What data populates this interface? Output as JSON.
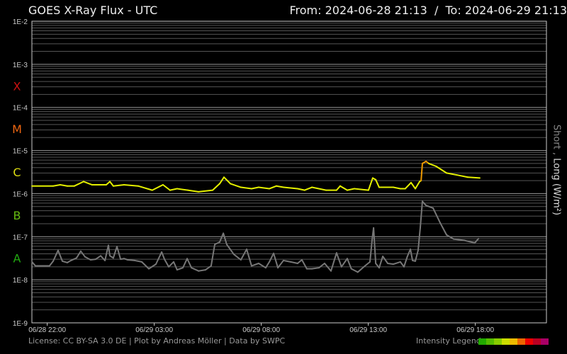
{
  "header": {
    "title": "GOES X-Ray Flux - UTC",
    "range": "From: 2024-06-28 21:13  /  To: 2024-06-29 21:13"
  },
  "footer": {
    "license": "License: CC BY-SA 3.0 DE | Plot by Andreas Möller | Data by SWPC",
    "legend_label": "Intensity Legend"
  },
  "legend_colors": [
    "#22aa00",
    "#55bb00",
    "#88cc00",
    "#ccdd00",
    "#eebb00",
    "#ee6600",
    "#ee0000",
    "#bb0022",
    "#aa0066"
  ],
  "chart_data": {
    "type": "line",
    "title": "GOES X-Ray Flux - UTC",
    "ylabel_short": "Short ,",
    "ylabel_long": "Long (W/m²)",
    "yscale": "log",
    "ylim": [
      1e-09,
      0.01
    ],
    "ytick_labels": [
      "1E-2",
      "1E-3",
      "1E-4",
      "1E-5",
      "1E-6",
      "1E-7",
      "1E-8",
      "1E-9"
    ],
    "classes": [
      {
        "label": "X",
        "color": "#cc1111",
        "log": -3.5
      },
      {
        "label": "M",
        "color": "#ee6611",
        "log": -4.5
      },
      {
        "label": "C",
        "color": "#dddd11",
        "log": -5.5
      },
      {
        "label": "B",
        "color": "#66bb11",
        "log": -6.5
      },
      {
        "label": "A",
        "color": "#22aa11",
        "log": -7.5
      }
    ],
    "xlim_hours": [
      0,
      24
    ],
    "x_start": "06/28 21:13",
    "xticks": [
      {
        "label": "06/28 22:00",
        "h": 0.783
      },
      {
        "label": "06/29 03:00",
        "h": 5.783
      },
      {
        "label": "06/29 08:00",
        "h": 10.783
      },
      {
        "label": "06/29 13:00",
        "h": 15.783
      },
      {
        "label": "06/29 18:00",
        "h": 20.783
      }
    ],
    "grid": true,
    "series": [
      {
        "name": "Long",
        "color": "#e4f000",
        "flare_color": "#ee9900",
        "points_x_pixels_note": "",
        "hours": [
          0.07,
          1.06,
          1.39,
          1.72,
          2.05,
          2.48,
          2.88,
          3.54,
          3.71,
          3.87,
          4.37,
          5.03,
          5.69,
          6.19,
          6.52,
          6.85,
          7.35,
          7.85,
          8.51,
          8.84,
          9.04,
          9.34,
          9.83,
          10.33,
          10.66,
          11.16,
          11.49,
          11.82,
          12.48,
          12.81,
          13.15,
          13.81,
          14.3,
          14.47,
          14.8,
          15.13,
          15.79,
          15.99,
          16.13,
          16.29,
          16.62,
          16.95,
          17.28,
          17.51,
          17.78,
          17.98,
          18.18,
          18.25,
          18.31,
          18.48,
          18.61,
          18.95,
          19.44,
          19.93,
          20.43,
          20.99
        ],
        "flux": [
          1.5e-06,
          1.5e-06,
          1.6e-06,
          1.5e-06,
          1.5e-06,
          1.9e-06,
          1.6e-06,
          1.6e-06,
          1.9e-06,
          1.5e-06,
          1.6e-06,
          1.5e-06,
          1.2e-06,
          1.6e-06,
          1.2e-06,
          1.3e-06,
          1.2e-06,
          1.1e-06,
          1.2e-06,
          1.7e-06,
          2.4e-06,
          1.7e-06,
          1.4e-06,
          1.3e-06,
          1.4e-06,
          1.3e-06,
          1.5e-06,
          1.4e-06,
          1.3e-06,
          1.2e-06,
          1.4e-06,
          1.2e-06,
          1.2e-06,
          1.5e-06,
          1.2e-06,
          1.3e-06,
          1.2e-06,
          2.3e-06,
          2.1e-06,
          1.4e-06,
          1.4e-06,
          1.4e-06,
          1.3e-06,
          1.3e-06,
          1.8e-06,
          1.3e-06,
          1.9e-06,
          2e-06,
          5e-06,
          5.6e-06,
          5e-06,
          4.3e-06,
          3e-06,
          2.7e-06,
          2.4e-06,
          2.3e-06
        ]
      },
      {
        "name": "Short",
        "color": "#777777",
        "hours": [
          0.07,
          0.23,
          0.56,
          0.89,
          1.06,
          1.29,
          1.49,
          1.72,
          1.89,
          2.15,
          2.35,
          2.55,
          2.81,
          3.05,
          3.28,
          3.48,
          3.64,
          3.71,
          3.87,
          4.04,
          4.21,
          4.37,
          4.54,
          4.87,
          5.2,
          5.53,
          5.86,
          6.13,
          6.26,
          6.46,
          6.69,
          6.85,
          7.12,
          7.32,
          7.52,
          7.85,
          8.18,
          8.44,
          8.61,
          8.84,
          9.01,
          9.17,
          9.5,
          9.83,
          10.1,
          10.33,
          10.66,
          10.99,
          11.16,
          11.36,
          11.56,
          11.82,
          12.15,
          12.48,
          12.68,
          12.91,
          13.15,
          13.48,
          13.74,
          14.04,
          14.3,
          14.53,
          14.8,
          14.99,
          15.29,
          15.63,
          15.86,
          15.96,
          16.03,
          16.13,
          16.29,
          16.46,
          16.69,
          16.95,
          17.28,
          17.45,
          17.61,
          17.75,
          17.85,
          17.98,
          18.11,
          18.21,
          18.31,
          18.48,
          18.81,
          19.14,
          19.44,
          19.77,
          20.26,
          20.76,
          20.93
        ],
        "flux": [
          2.6e-08,
          2.1e-08,
          2.1e-08,
          2.1e-08,
          2.7e-08,
          4.8e-08,
          2.7e-08,
          2.5e-08,
          2.8e-08,
          3.2e-08,
          4.6e-08,
          3.4e-08,
          2.9e-08,
          3e-08,
          3.6e-08,
          2.8e-08,
          6.3e-08,
          3.6e-08,
          3.2e-08,
          5.9e-08,
          3e-08,
          3.1e-08,
          2.9e-08,
          2.8e-08,
          2.6e-08,
          1.8e-08,
          2.3e-08,
          4.4e-08,
          3e-08,
          2e-08,
          2.6e-08,
          1.7e-08,
          1.9e-08,
          3.1e-08,
          1.9e-08,
          1.6e-08,
          1.7e-08,
          2.1e-08,
          6.6e-08,
          7.5e-08,
          1.2e-07,
          6.6e-08,
          3.9e-08,
          2.9e-08,
          5.1e-08,
          2.1e-08,
          2.4e-08,
          1.9e-08,
          2.6e-08,
          4.1e-08,
          1.9e-08,
          2.8e-08,
          2.6e-08,
          2.4e-08,
          2.9e-08,
          1.8e-08,
          1.8e-08,
          1.9e-08,
          2.4e-08,
          1.6e-08,
          4.2e-08,
          2e-08,
          3.1e-08,
          1.8e-08,
          1.5e-08,
          2.1e-08,
          2.6e-08,
          8.3e-08,
          1.6e-07,
          2.4e-08,
          1.9e-08,
          3.5e-08,
          2.4e-08,
          2.3e-08,
          2.6e-08,
          2e-08,
          3.5e-08,
          5.1e-08,
          2.8e-08,
          2.7e-08,
          4.8e-08,
          1.6e-07,
          6.6e-07,
          5.3e-07,
          4.6e-07,
          2.1e-07,
          1.1e-07,
          8.8e-08,
          8.2e-08,
          7.2e-08,
          9e-08
        ]
      }
    ]
  }
}
